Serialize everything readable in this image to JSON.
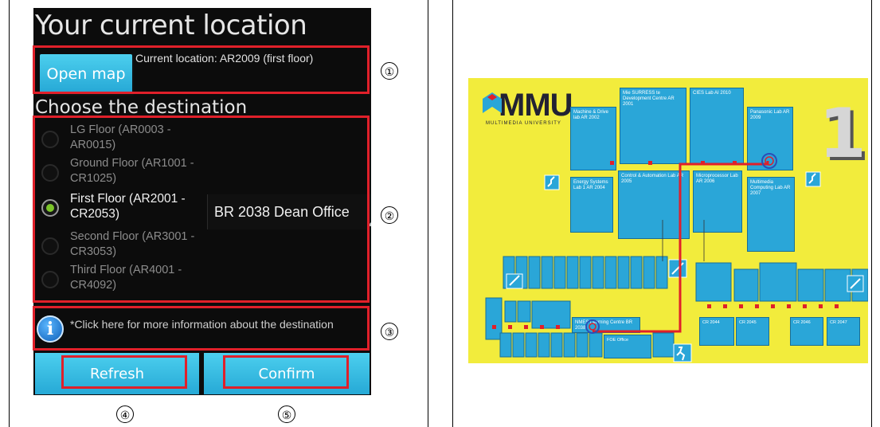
{
  "phone": {
    "title": "Your current location",
    "open_map_label": "Open map",
    "current_location": "Current location: AR2009 (first floor)",
    "choose_heading": "Choose the destination",
    "floors": [
      {
        "label": "LG Floor (AR0003 - AR0015)",
        "checked": false
      },
      {
        "label": "Ground Floor (AR1001 - CR1025)",
        "checked": false
      },
      {
        "label": "First Floor (AR2001 - CR2053)",
        "checked": true
      },
      {
        "label": "Second Floor (AR3001 - CR3053)",
        "checked": false
      },
      {
        "label": "Third Floor (AR4001 - CR4092)",
        "checked": false
      }
    ],
    "destination_value": "BR 2038 Dean Office",
    "info_text": "*Click here for more information about the destination",
    "refresh_label": "Refresh",
    "confirm_label": "Confirm"
  },
  "callouts": [
    "①",
    "②",
    "③",
    "④",
    "⑤"
  ],
  "map": {
    "logo": "MMU",
    "logo_sub": "MULTIMEDIA UNIVERSITY",
    "floor_number": "1",
    "rooms": {
      "machine": "Machine & Drive lab AR 2002",
      "mesuress": "Mie SURRESS te Development Centre AR 2001",
      "cies": "CIES Lab AI 2010",
      "panasonic": "Panasonic Lab AR 2009",
      "energy": "Energy Systems Lab 1 AR 2004",
      "control": "Control & Automation Lab AR 2005",
      "micro": "Microprocessor Lab AR 2006",
      "multimedia": "Multimedia Computing Lab AR 2007",
      "nmes": "NMES Learning Centre BR 2038",
      "foe": "FOE Office",
      "cr2044": "CR 2044",
      "cr2045": "CR 2045",
      "cr2046": "CR 2046",
      "cr2047": "CR 2047"
    }
  }
}
